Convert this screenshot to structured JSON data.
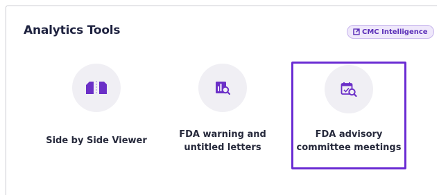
{
  "panel": {
    "title": "Analytics Tools",
    "badge": {
      "label": "CMC Intelligence",
      "icon": "external-link-icon"
    }
  },
  "tools": [
    {
      "label": "Side by Side Viewer",
      "icon": "side-by-side-icon",
      "selected": false
    },
    {
      "label_line1": "FDA warning and",
      "label_line2": "untitled letters",
      "icon": "document-chart-search-icon",
      "selected": false
    },
    {
      "label_line1": "FDA advisory",
      "label_line2": "committee meetings",
      "icon": "calendar-search-icon",
      "selected": true
    }
  ],
  "colors": {
    "accent": "#6a2bd3",
    "title": "#1f2340",
    "icon_fill": "#6b2fc7",
    "badge_bg": "#efe8fb"
  }
}
